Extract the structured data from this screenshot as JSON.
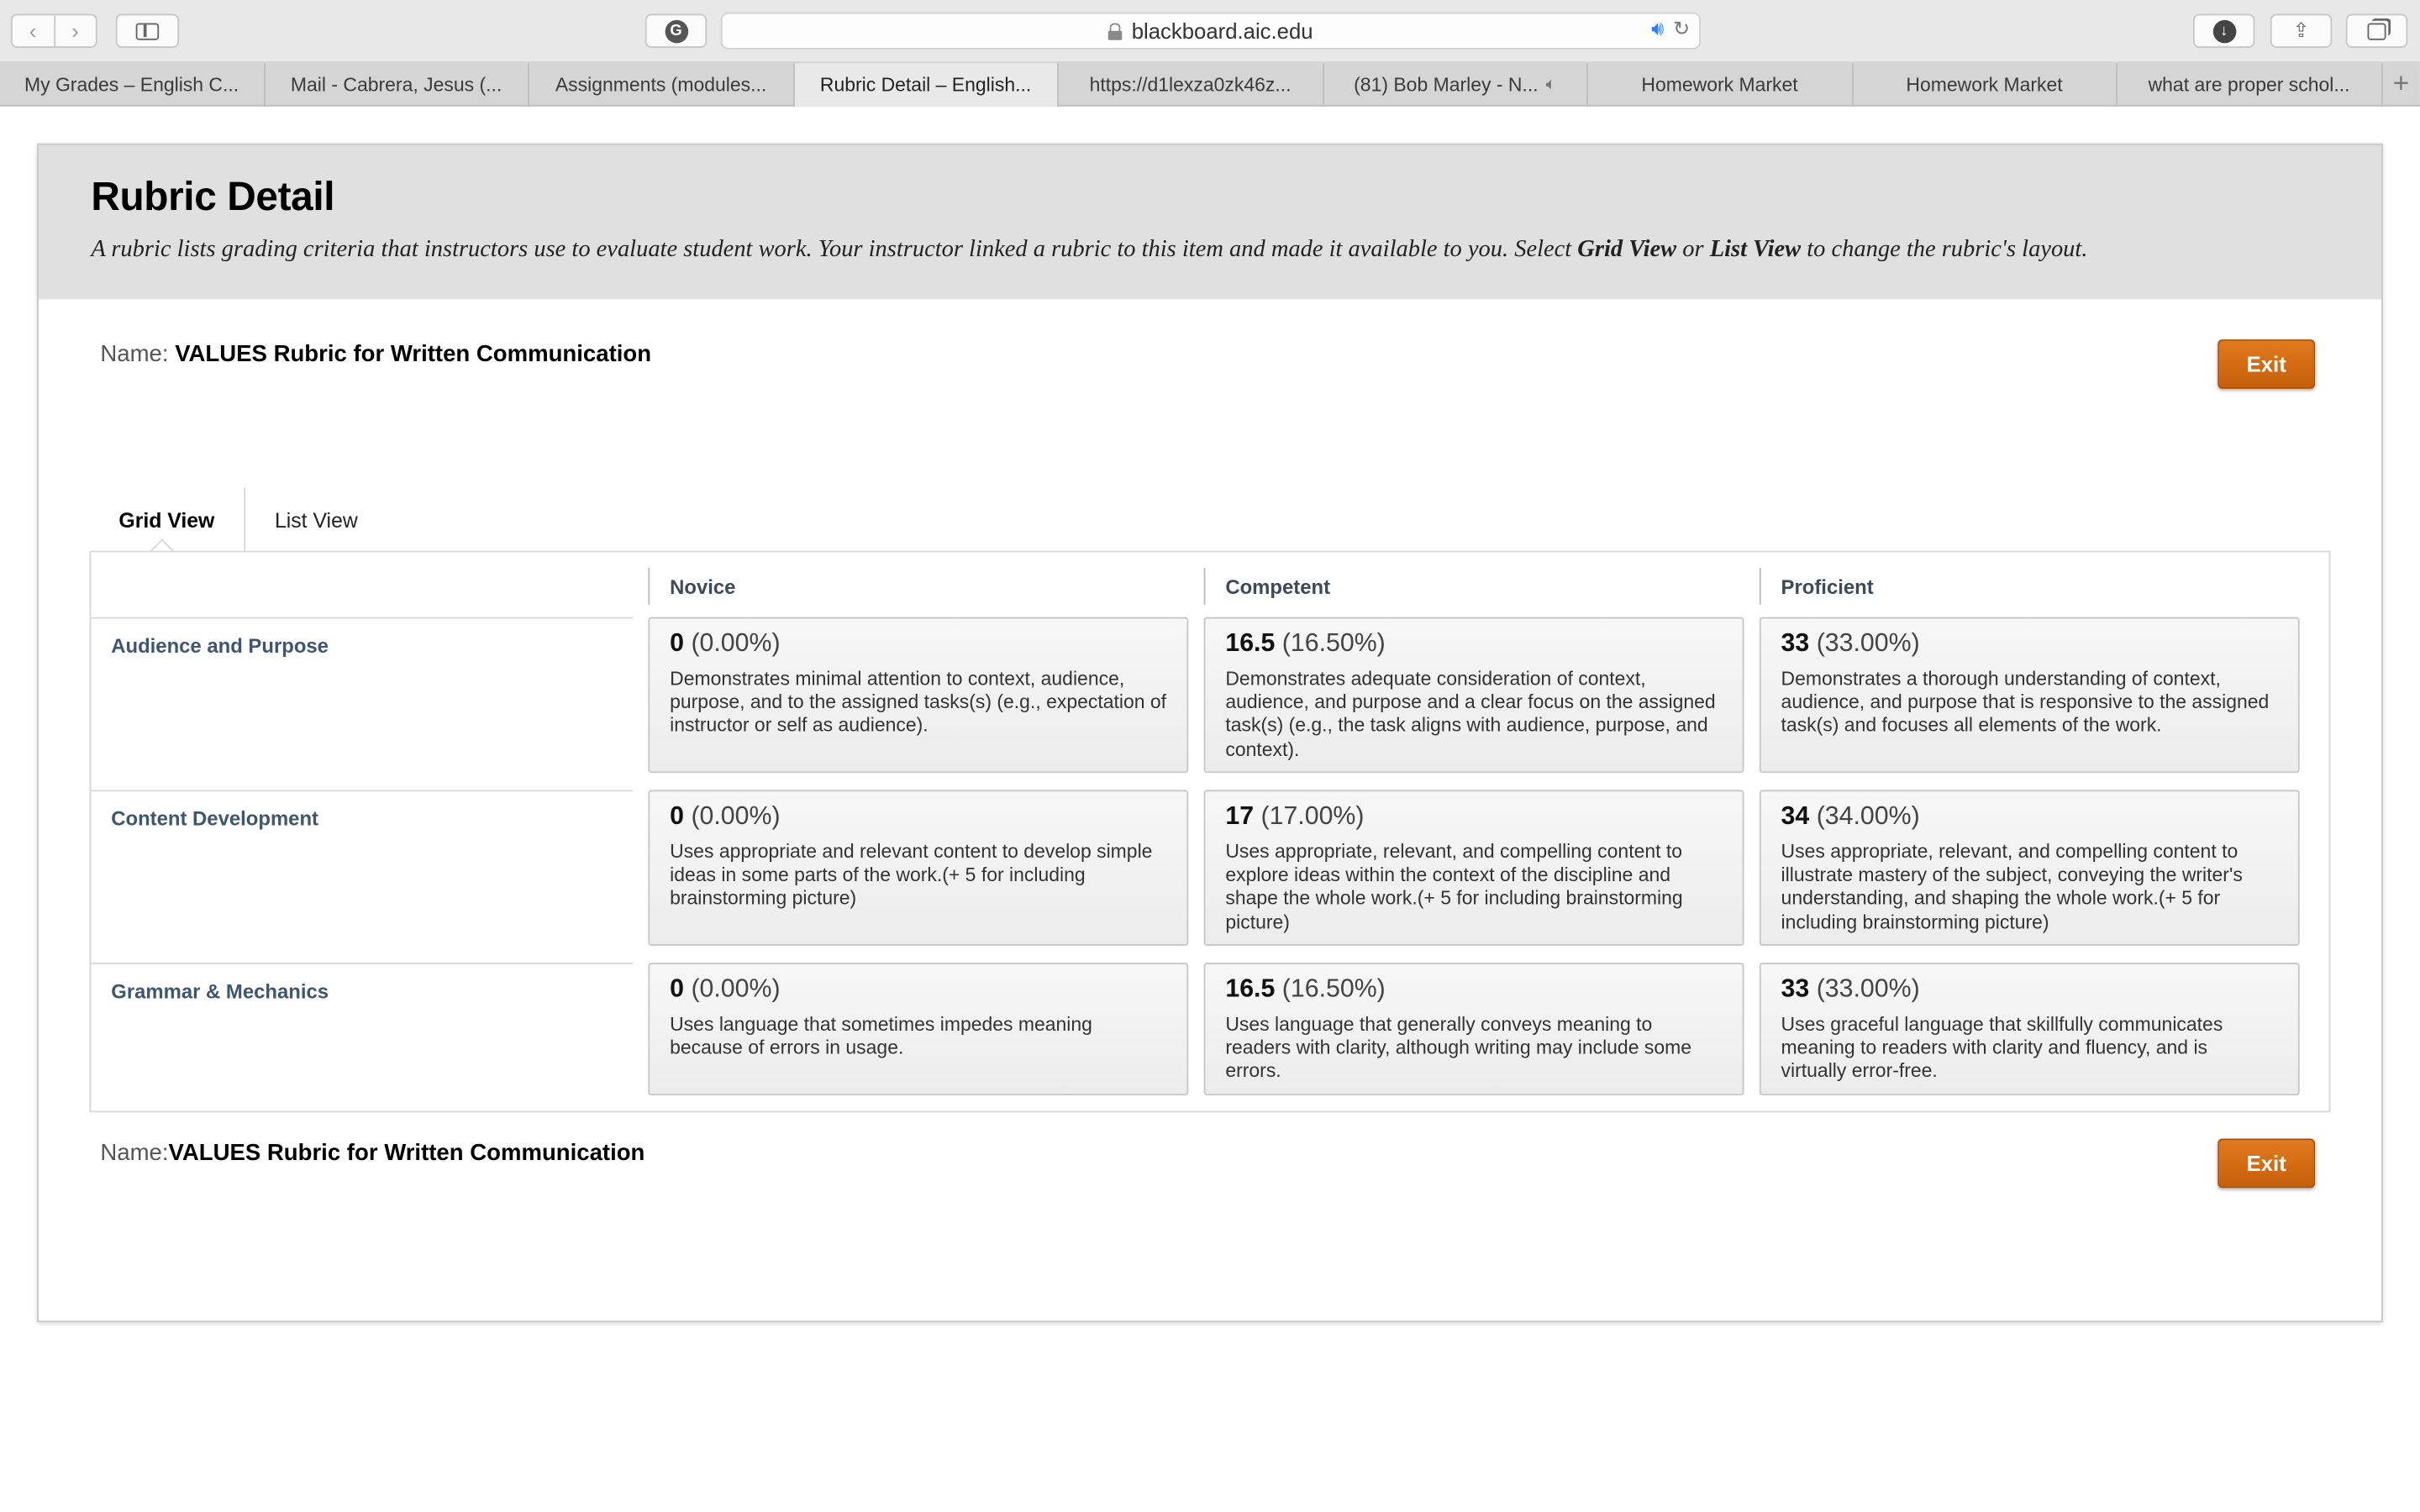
{
  "browser": {
    "url": "blackboard.aic.edu",
    "tabs": [
      {
        "label": "My Grades – English C...",
        "active": false,
        "muted": false
      },
      {
        "label": "Mail - Cabrera, Jesus (...",
        "active": false,
        "muted": false
      },
      {
        "label": "Assignments (modules...",
        "active": false,
        "muted": false
      },
      {
        "label": "Rubric Detail – English...",
        "active": true,
        "muted": false
      },
      {
        "label": "https://d1lexza0zk46z...",
        "active": false,
        "muted": false
      },
      {
        "label": "(81) Bob Marley - N...",
        "active": false,
        "muted": true
      },
      {
        "label": "Homework Market",
        "active": false,
        "muted": false
      },
      {
        "label": "Homework Market",
        "active": false,
        "muted": false
      },
      {
        "label": "what are proper schol...",
        "active": false,
        "muted": false
      }
    ]
  },
  "page": {
    "title": "Rubric Detail",
    "description_start": "A rubric lists grading criteria that instructors use to evaluate student work. Your instructor linked a rubric to this item and made it available to you. Select ",
    "grid_view_em": "Grid View",
    "description_or": " or ",
    "list_view_em": "List View",
    "description_end": " to change the rubric's layout.",
    "name_label_top": "Name: ",
    "name_label_bottom": "Name:",
    "rubric_name": "VALUES Rubric for Written Communication",
    "exit_label": "Exit"
  },
  "view_tabs": {
    "grid": "Grid View",
    "list": "List View"
  },
  "rubric": {
    "columns": [
      "Novice",
      "Competent",
      "Proficient"
    ],
    "rows": [
      {
        "criterion": "Audience and Purpose",
        "cells": [
          {
            "points": "0",
            "percent": "(0.00%)",
            "desc": "Demonstrates minimal attention to context, audience, purpose, and to the assigned tasks(s) (e.g., expectation of instructor or self as audience)."
          },
          {
            "points": "16.5",
            "percent": "(16.50%)",
            "desc": "Demonstrates adequate consideration of context, audience, and purpose and a clear focus on the assigned task(s) (e.g., the task aligns with audience, purpose, and context)."
          },
          {
            "points": "33",
            "percent": "(33.00%)",
            "desc": "Demonstrates a thorough understanding of context, audience, and purpose that is responsive to the assigned task(s) and focuses all elements of the work."
          }
        ]
      },
      {
        "criterion": "Content Development",
        "cells": [
          {
            "points": "0",
            "percent": "(0.00%)",
            "desc": "Uses appropriate and relevant content to develop simple ideas in some parts of the work.(+ 5 for including brainstorming picture)"
          },
          {
            "points": "17",
            "percent": "(17.00%)",
            "desc": "Uses appropriate, relevant, and compelling content to explore ideas within the context of the discipline and shape the whole work.(+ 5 for including brainstorming picture)"
          },
          {
            "points": "34",
            "percent": "(34.00%)",
            "desc": "Uses appropriate, relevant, and compelling content to illustrate mastery of the subject, conveying the writer's understanding, and shaping the whole work.(+ 5 for including brainstorming picture)"
          }
        ]
      },
      {
        "criterion": "Grammar & Mechanics",
        "cells": [
          {
            "points": "0",
            "percent": "(0.00%)",
            "desc": "Uses language that sometimes impedes meaning because of errors in usage."
          },
          {
            "points": "16.5",
            "percent": "(16.50%)",
            "desc": "Uses language that generally conveys meaning to readers with clarity, although writing may include some errors."
          },
          {
            "points": "33",
            "percent": "(33.00%)",
            "desc": "Uses graceful language that skillfully communicates meaning to readers with clarity and fluency, and is virtually error-free."
          }
        ]
      }
    ]
  },
  "colors": {
    "exit_button": "#d56c14",
    "criterion_text": "#3e5670",
    "header_bg": "#e0e0e0"
  }
}
